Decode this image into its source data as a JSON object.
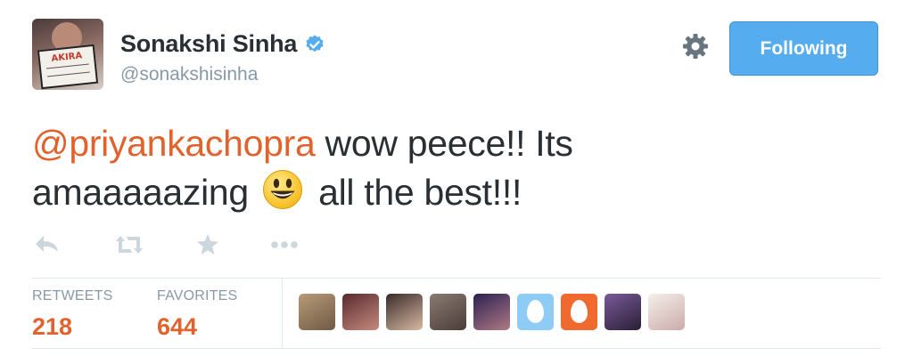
{
  "profile": {
    "name": "Sonakshi Sinha",
    "handle": "@sonakshisinha",
    "verified": true,
    "avatar_clapper_text": "AKIRA"
  },
  "follow_button": {
    "label": "Following",
    "color": "#55acee"
  },
  "settings_icon": "gear-icon",
  "tweet": {
    "mention": "@priyankachopra",
    "text_before_emoji": " wow peece!! Its amaaaaazing ",
    "emoji": "smiley-emoji",
    "text_after_emoji": " all the best!!!",
    "mention_color": "#e1622c"
  },
  "actions": [
    {
      "name": "reply-icon"
    },
    {
      "name": "retweet-icon"
    },
    {
      "name": "favorite-icon"
    },
    {
      "name": "more-icon"
    }
  ],
  "stats": {
    "retweets_label": "RETWEETS",
    "retweets_value": "218",
    "favorites_label": "FAVORITES",
    "favorites_value": "644",
    "value_color": "#e1622c"
  },
  "favoriters": [
    {
      "type": "photo",
      "colors": [
        "#b89a78",
        "#6f5a44"
      ]
    },
    {
      "type": "photo",
      "colors": [
        "#5a2a2e",
        "#c58a7e"
      ]
    },
    {
      "type": "photo",
      "colors": [
        "#3a2a2a",
        "#d7b9a1"
      ]
    },
    {
      "type": "photo",
      "colors": [
        "#8a7a72",
        "#4a3d38"
      ]
    },
    {
      "type": "photo",
      "colors": [
        "#2b2050",
        "#b07a86"
      ]
    },
    {
      "type": "egg",
      "colors": [
        "#8ecbf5",
        "#8ecbf5"
      ]
    },
    {
      "type": "egg",
      "colors": [
        "#f06a2f",
        "#f06a2f"
      ]
    },
    {
      "type": "photo",
      "colors": [
        "#7a5a9a",
        "#2a1f35"
      ]
    },
    {
      "type": "photo",
      "colors": [
        "#f4f0ea",
        "#caa"
      ]
    }
  ]
}
